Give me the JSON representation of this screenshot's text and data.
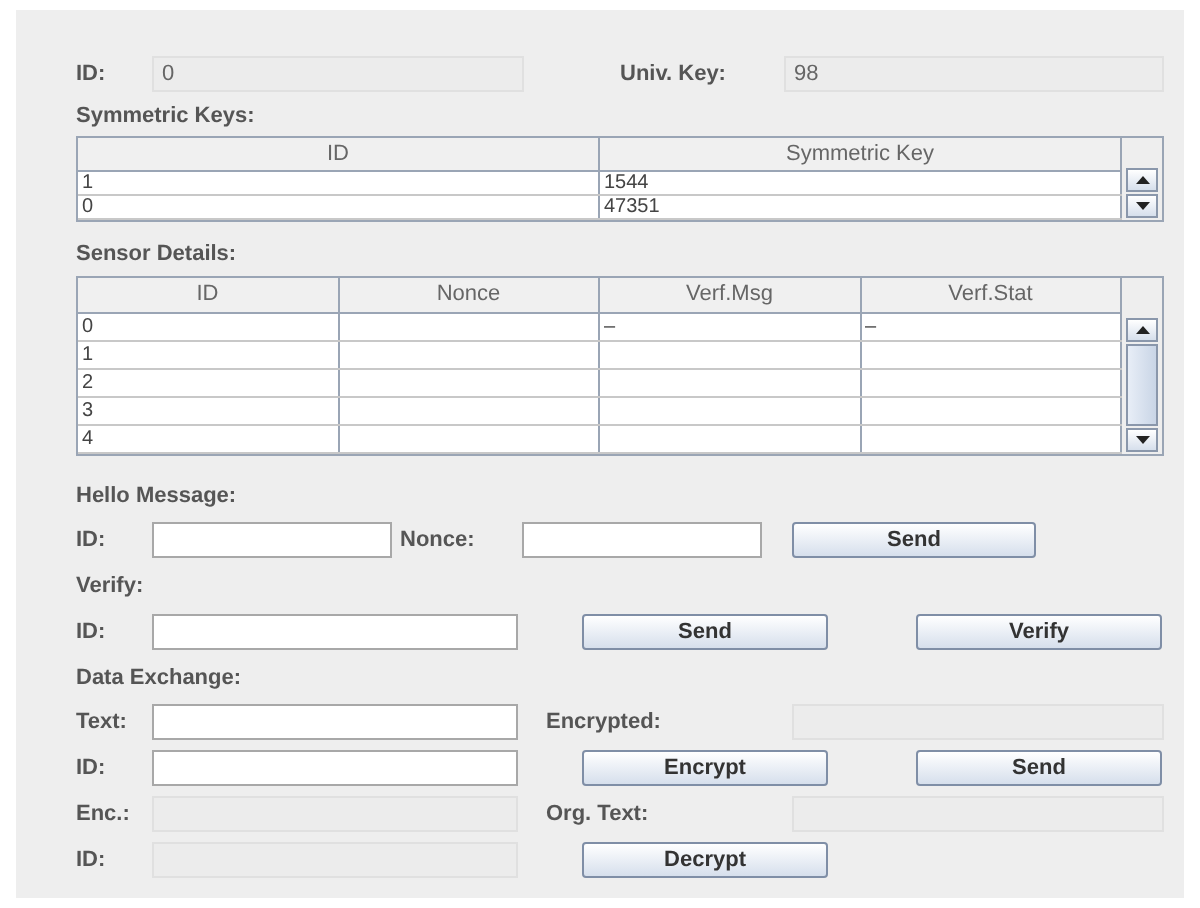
{
  "identity": {
    "id": {
      "label": "ID:",
      "value": "0",
      "disabled": true
    },
    "univ_key": {
      "label": "Univ. Key:",
      "value": "98",
      "disabled": true
    }
  },
  "symmetric_keys": {
    "title": "Symmetric Keys:",
    "columns": [
      "ID",
      "Symmetric Key"
    ],
    "rows": [
      [
        "1",
        "1544"
      ],
      [
        "0",
        "47351"
      ]
    ]
  },
  "sensor_details": {
    "title": "Sensor Details:",
    "columns": [
      "ID",
      "Nonce",
      "Verf.Msg",
      "Verf.Stat"
    ],
    "rows": [
      {
        "id": "0",
        "verf_msg": "–",
        "verf_stat": "–"
      },
      {
        "id": "1"
      },
      {
        "id": "2"
      },
      {
        "id": "3"
      },
      {
        "id": "4"
      }
    ]
  },
  "hello_message": {
    "title": "Hello Message:",
    "id_label": "ID:",
    "nonce_label": "Nonce:",
    "button": "Send"
  },
  "verify": {
    "title": "Verify:",
    "id_label": "ID:",
    "send_button": "Send",
    "verify_button": "Verify"
  },
  "data_exchange": {
    "title": "Data Exchange:",
    "text_label": "Text:",
    "encrypted": {
      "label": "Encrypted:",
      "disabled": true
    },
    "id_label": "ID:",
    "encrypt_button": "Encrypt",
    "send_button": "Send",
    "enc": {
      "label": "Enc.:",
      "disabled": true
    },
    "org_text": {
      "label": "Org. Text:",
      "disabled": true
    },
    "id2": {
      "label": "ID:",
      "disabled": true
    },
    "decrypt_button": "Decrypt"
  }
}
